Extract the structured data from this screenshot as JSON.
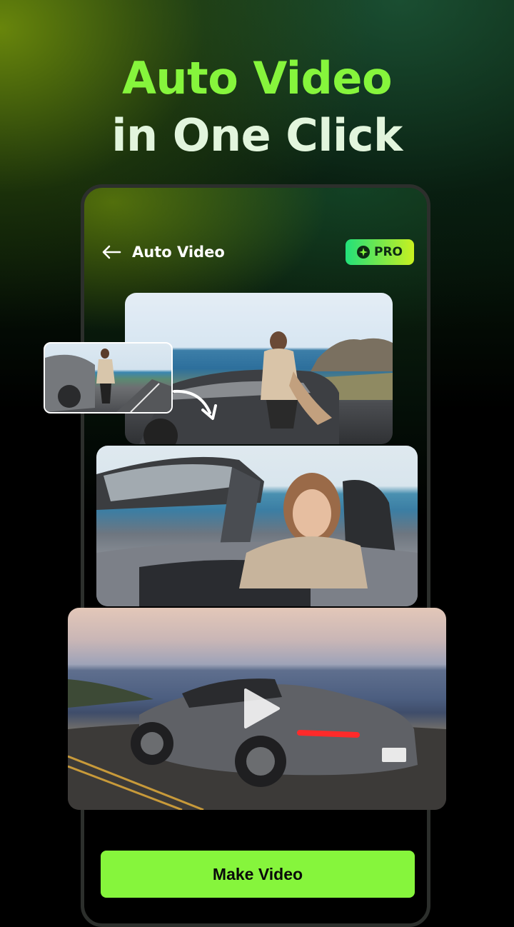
{
  "headline": {
    "line1": "Auto Video",
    "line2": "in One Click"
  },
  "app": {
    "title": "Auto Video",
    "pro_label": "PRO",
    "back_icon": "back-arrow-icon",
    "pro_icon": "sparkle-icon"
  },
  "media": {
    "thumbnail": "source-thumbnail",
    "previews": [
      "preview-image-coast",
      "preview-image-driver",
      "video-preview"
    ],
    "play_icon": "play-icon"
  },
  "actions": {
    "make_video_label": "Make Video"
  },
  "colors": {
    "accent_green": "#86f53c",
    "headline_secondary": "#e2f5dd",
    "pro_gradient_start": "#22e07a",
    "pro_gradient_end": "#c8f020",
    "background": "#000000"
  }
}
